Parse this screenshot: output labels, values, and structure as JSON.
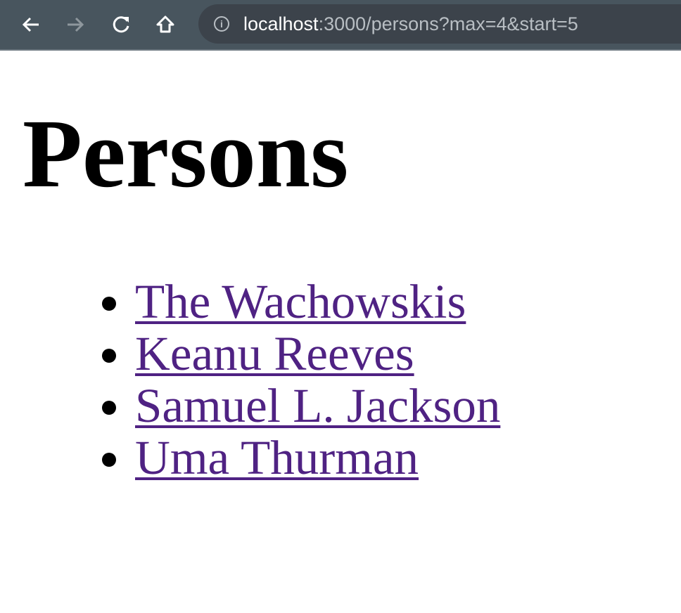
{
  "browser": {
    "url_host": "localhost",
    "url_rest": ":3000/persons?max=4&start=5",
    "icons": [
      "back-arrow-icon",
      "forward-arrow-icon",
      "reload-icon",
      "home-icon",
      "info-icon"
    ]
  },
  "page": {
    "title": "Persons",
    "persons": [
      "The Wachowskis",
      "Keanu Reeves",
      "Samuel L. Jackson",
      "Uma Thurman"
    ],
    "link_color": "#4f2283"
  }
}
